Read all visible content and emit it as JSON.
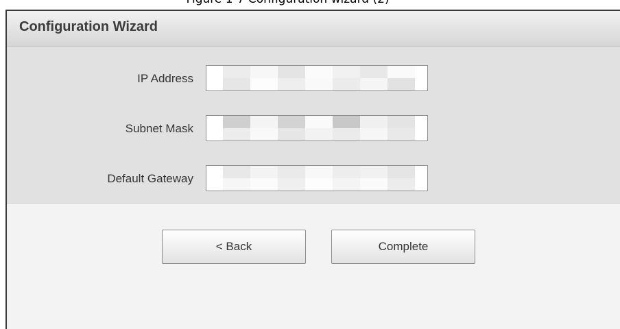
{
  "caption": "Figure 1-7 Configuration wizard (2)",
  "dialog": {
    "title": "Configuration Wizard",
    "fields": [
      {
        "label": "IP Address",
        "value": ""
      },
      {
        "label": "Subnet Mask",
        "value": ""
      },
      {
        "label": "Default Gateway",
        "value": ""
      }
    ],
    "buttons": {
      "back": "< Back",
      "complete": "Complete"
    }
  }
}
